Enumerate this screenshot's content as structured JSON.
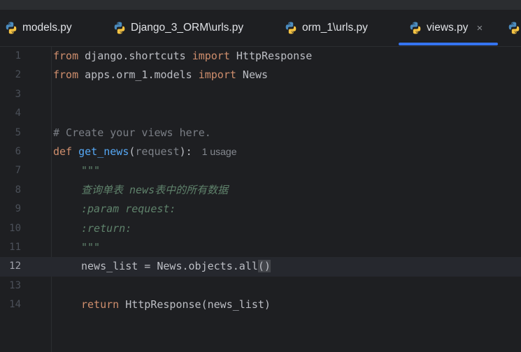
{
  "tabs": [
    {
      "label": "models.py",
      "active": false
    },
    {
      "label": "Django_3_ORM\\urls.py",
      "active": false
    },
    {
      "label": "orm_1\\urls.py",
      "active": false
    },
    {
      "label": "views.py",
      "active": true,
      "close": "×"
    }
  ],
  "editor": {
    "active_line": 12,
    "line_numbers": [
      "1",
      "2",
      "3",
      "4",
      "5",
      "6",
      "7",
      "8",
      "9",
      "10",
      "11",
      "12",
      "13",
      "14"
    ],
    "line1": {
      "kw1": "from",
      "mod": " django.shortcuts ",
      "kw2": "import",
      "name": " HttpResponse"
    },
    "line2": {
      "kw1": "from",
      "mod": " apps.orm_1.models ",
      "kw2": "import",
      "name": " News"
    },
    "line5": {
      "comment": "# Create your views here."
    },
    "line6": {
      "kw": "def",
      "fn": "get_news",
      "open": "(",
      "param": "request",
      "close": "):",
      "hint": "1 usage"
    },
    "line7": {
      "doc": "\"\"\""
    },
    "line8": {
      "doc": "查询单表 news表中的所有数据"
    },
    "line9": {
      "doc": ":param request:"
    },
    "line10": {
      "doc": ":return:"
    },
    "line11": {
      "doc": "\"\"\""
    },
    "line12": {
      "pre": "news_list = News.objects.all",
      "open": "(",
      "close": ")"
    },
    "line14": {
      "kw": "return",
      "rest": " HttpResponse(news_list)"
    }
  },
  "colors": {
    "keyword": "#cf8e6d",
    "function": "#56a8f5",
    "docstring": "#5f826b",
    "comment": "#7a7e85",
    "text": "#bcbec4",
    "tab_underline": "#3574f0"
  },
  "icons": {
    "tab_file": "python-icon",
    "close": "close-icon"
  }
}
